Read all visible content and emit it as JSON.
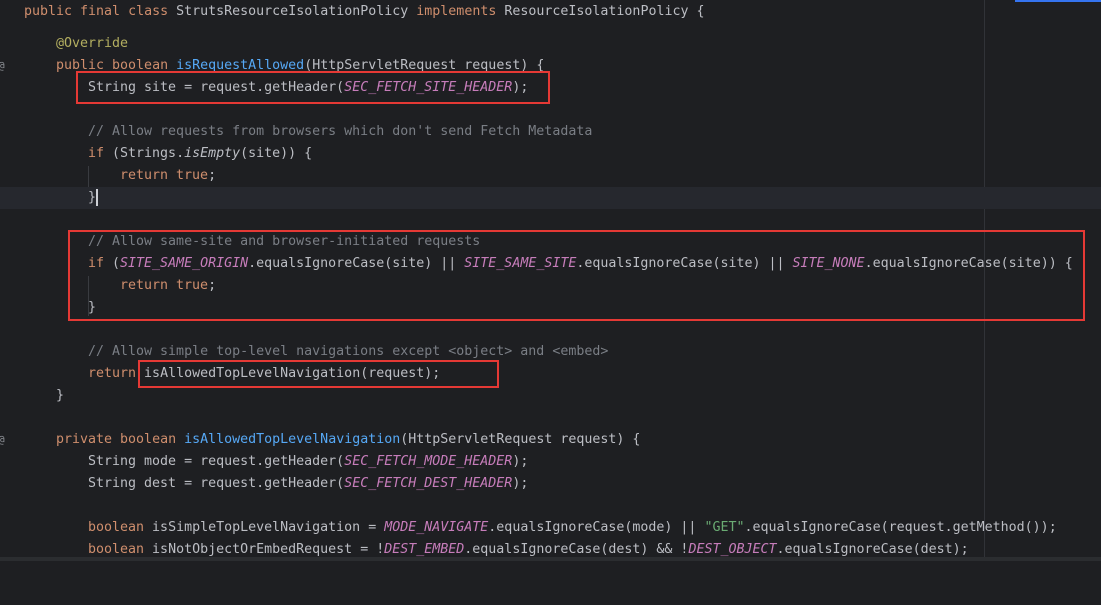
{
  "colors": {
    "background": "#1e1f22",
    "keyword": "#cf8e6d",
    "annotation": "#b3ae60",
    "method": "#56a8f5",
    "constant": "#c77dbb",
    "comment": "#7a7e85",
    "string": "#6aab73",
    "highlight_box": "#e53935"
  },
  "icons": {
    "override_marker": "@",
    "override_marker_2": "@"
  },
  "lines": {
    "l1": {
      "kw": "public final class",
      "name": " StrutsResourceIsolationPolicy ",
      "kw2": "implements",
      "rest": " ResourceIsolationPolicy {"
    },
    "l2": {
      "ann": "@Override"
    },
    "l3": {
      "kw": "public boolean ",
      "fn": "isRequestAllowed",
      "rest": "(HttpServletRequest request) {"
    },
    "l4": {
      "pre": "String site = request.getHeader(",
      "const": "SEC_FETCH_SITE_HEADER",
      "post": ");"
    },
    "l6": {
      "cmt": "// Allow requests from browsers which don't send Fetch Metadata"
    },
    "l7": {
      "kw": "if",
      "pre": " (Strings.",
      "static": "isEmpty",
      "post": "(site)) {"
    },
    "l8": {
      "kw": "return true",
      "post": ";"
    },
    "l9": {
      "post": "}"
    },
    "l11": {
      "cmt": "// Allow same-site and browser-initiated requests"
    },
    "l12": {
      "kw": "if",
      "p1": " (",
      "c1": "SITE_SAME_ORIGIN",
      "p2": ".equalsIgnoreCase(site) || ",
      "c2": "SITE_SAME_SITE",
      "p3": ".equalsIgnoreCase(site) || ",
      "c3": "SITE_NONE",
      "p4": ".equalsIgnoreCase(site)) {"
    },
    "l13": {
      "kw": "return true",
      "post": ";"
    },
    "l14": {
      "post": "}"
    },
    "l16": {
      "cmt": "// Allow simple top-level navigations except <object> and <embed>"
    },
    "l17": {
      "kw": "return",
      "post": " isAllowedTopLevelNavigation(request);"
    },
    "l18": {
      "post": "}"
    },
    "l20": {
      "kw": "private boolean ",
      "fn": "isAllowedTopLevelNavigation",
      "rest": "(HttpServletRequest request) {"
    },
    "l21": {
      "pre": "String mode = request.getHeader(",
      "const": "SEC_FETCH_MODE_HEADER",
      "post": ");"
    },
    "l22": {
      "pre": "String dest = request.getHeader(",
      "const": "SEC_FETCH_DEST_HEADER",
      "post": ");"
    },
    "l24": {
      "kw": "boolean",
      "p1": " isSimpleTopLevelNavigation = ",
      "c1": "MODE_NAVIGATE",
      "p2": ".equalsIgnoreCase(mode) || ",
      "str": "\"GET\"",
      "p3": ".equalsIgnoreCase(request.getMethod());"
    },
    "l25": {
      "kw": "boolean",
      "p1": " isNotObjectOrEmbedRequest = !",
      "c1": "DEST_EMBED",
      "p2": ".equalsIgnoreCase(dest) && !",
      "c2": "DEST_OBJECT",
      "p3": ".equalsIgnoreCase(dest);"
    }
  }
}
